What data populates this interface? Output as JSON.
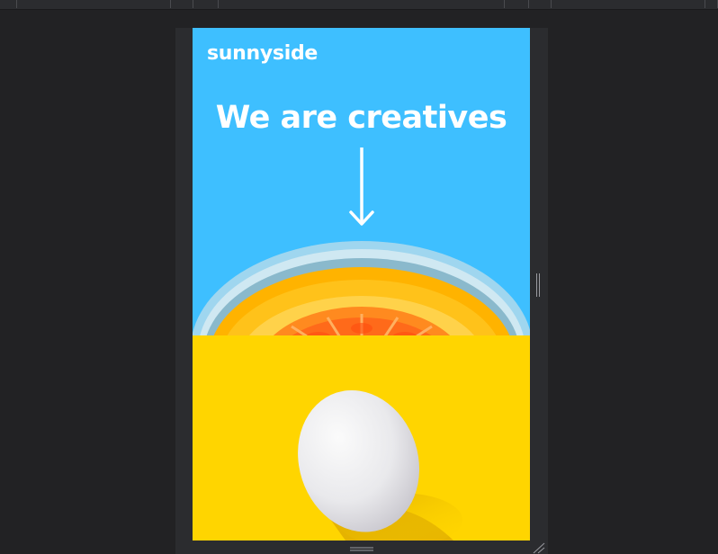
{
  "site": {
    "logo": "sunnyside",
    "headline": "We are creatives"
  },
  "icons": {
    "arrow": "arrow-down-icon",
    "resize": "resize-corner-icon",
    "drag_handle": "drag-handle-icon"
  },
  "colors": {
    "hero_bg": "#3ebfff",
    "egg_bg": "#ffd500",
    "devtools_bg": "#222224",
    "text": "#ffffff"
  }
}
